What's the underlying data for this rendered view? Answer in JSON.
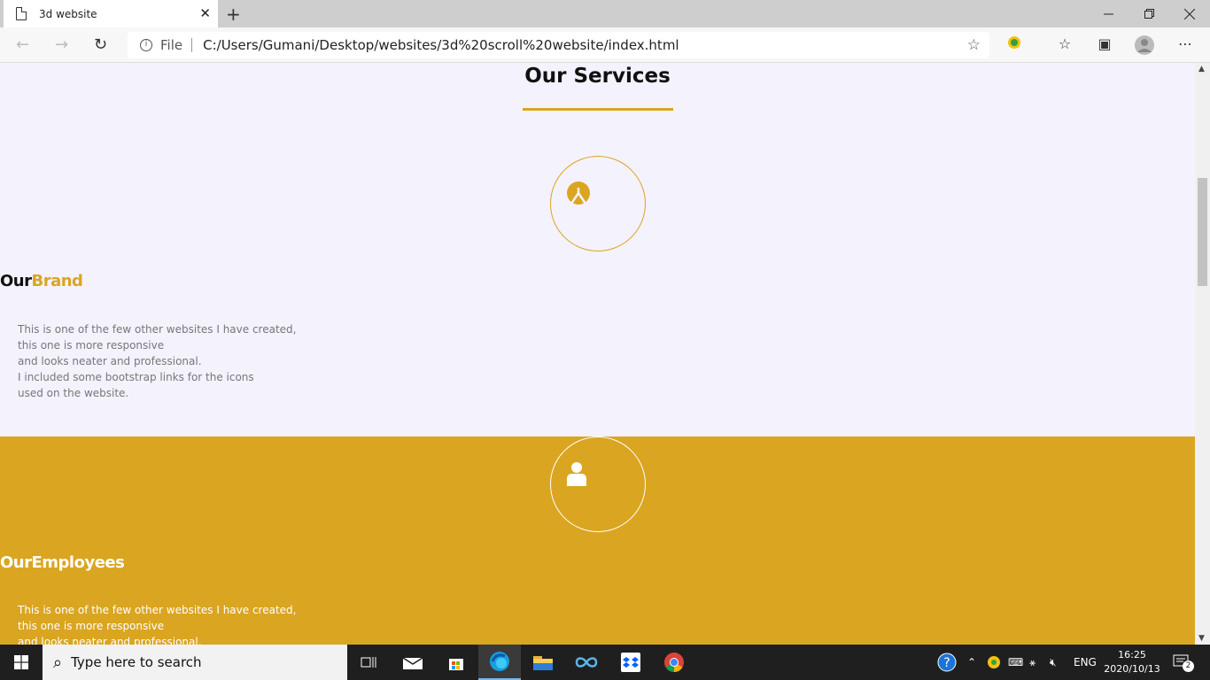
{
  "browser": {
    "tab_title": "3d website",
    "tab_close": "✕",
    "new_tab": "+",
    "address_prefix": "File",
    "url": "C:/Users/Gumani/Desktop/websites/3d%20scroll%20website/index.html"
  },
  "page": {
    "services_title": "Our Services",
    "brand": {
      "heading_plain": "Our",
      "heading_accent": "Brand",
      "text_lines": [
        "This is one of the few other websites I have created,",
        "this one is more responsive",
        "and looks neater and professional.",
        "I included some bootstrap links for the icons",
        "used on the website."
      ]
    },
    "employees": {
      "heading_plain": "Our",
      "heading_accent": "Employees",
      "text_lines": [
        "This is one of the few other websites I have created,",
        "this one is more responsive",
        "and looks neater and professional."
      ]
    }
  },
  "colors": {
    "accent": "#daa520",
    "page_bg": "#f4f2fc"
  },
  "taskbar": {
    "search_placeholder": "Type here to search",
    "language": "ENG",
    "time": "16:25",
    "date": "2020/10/13",
    "notifications": "2"
  }
}
